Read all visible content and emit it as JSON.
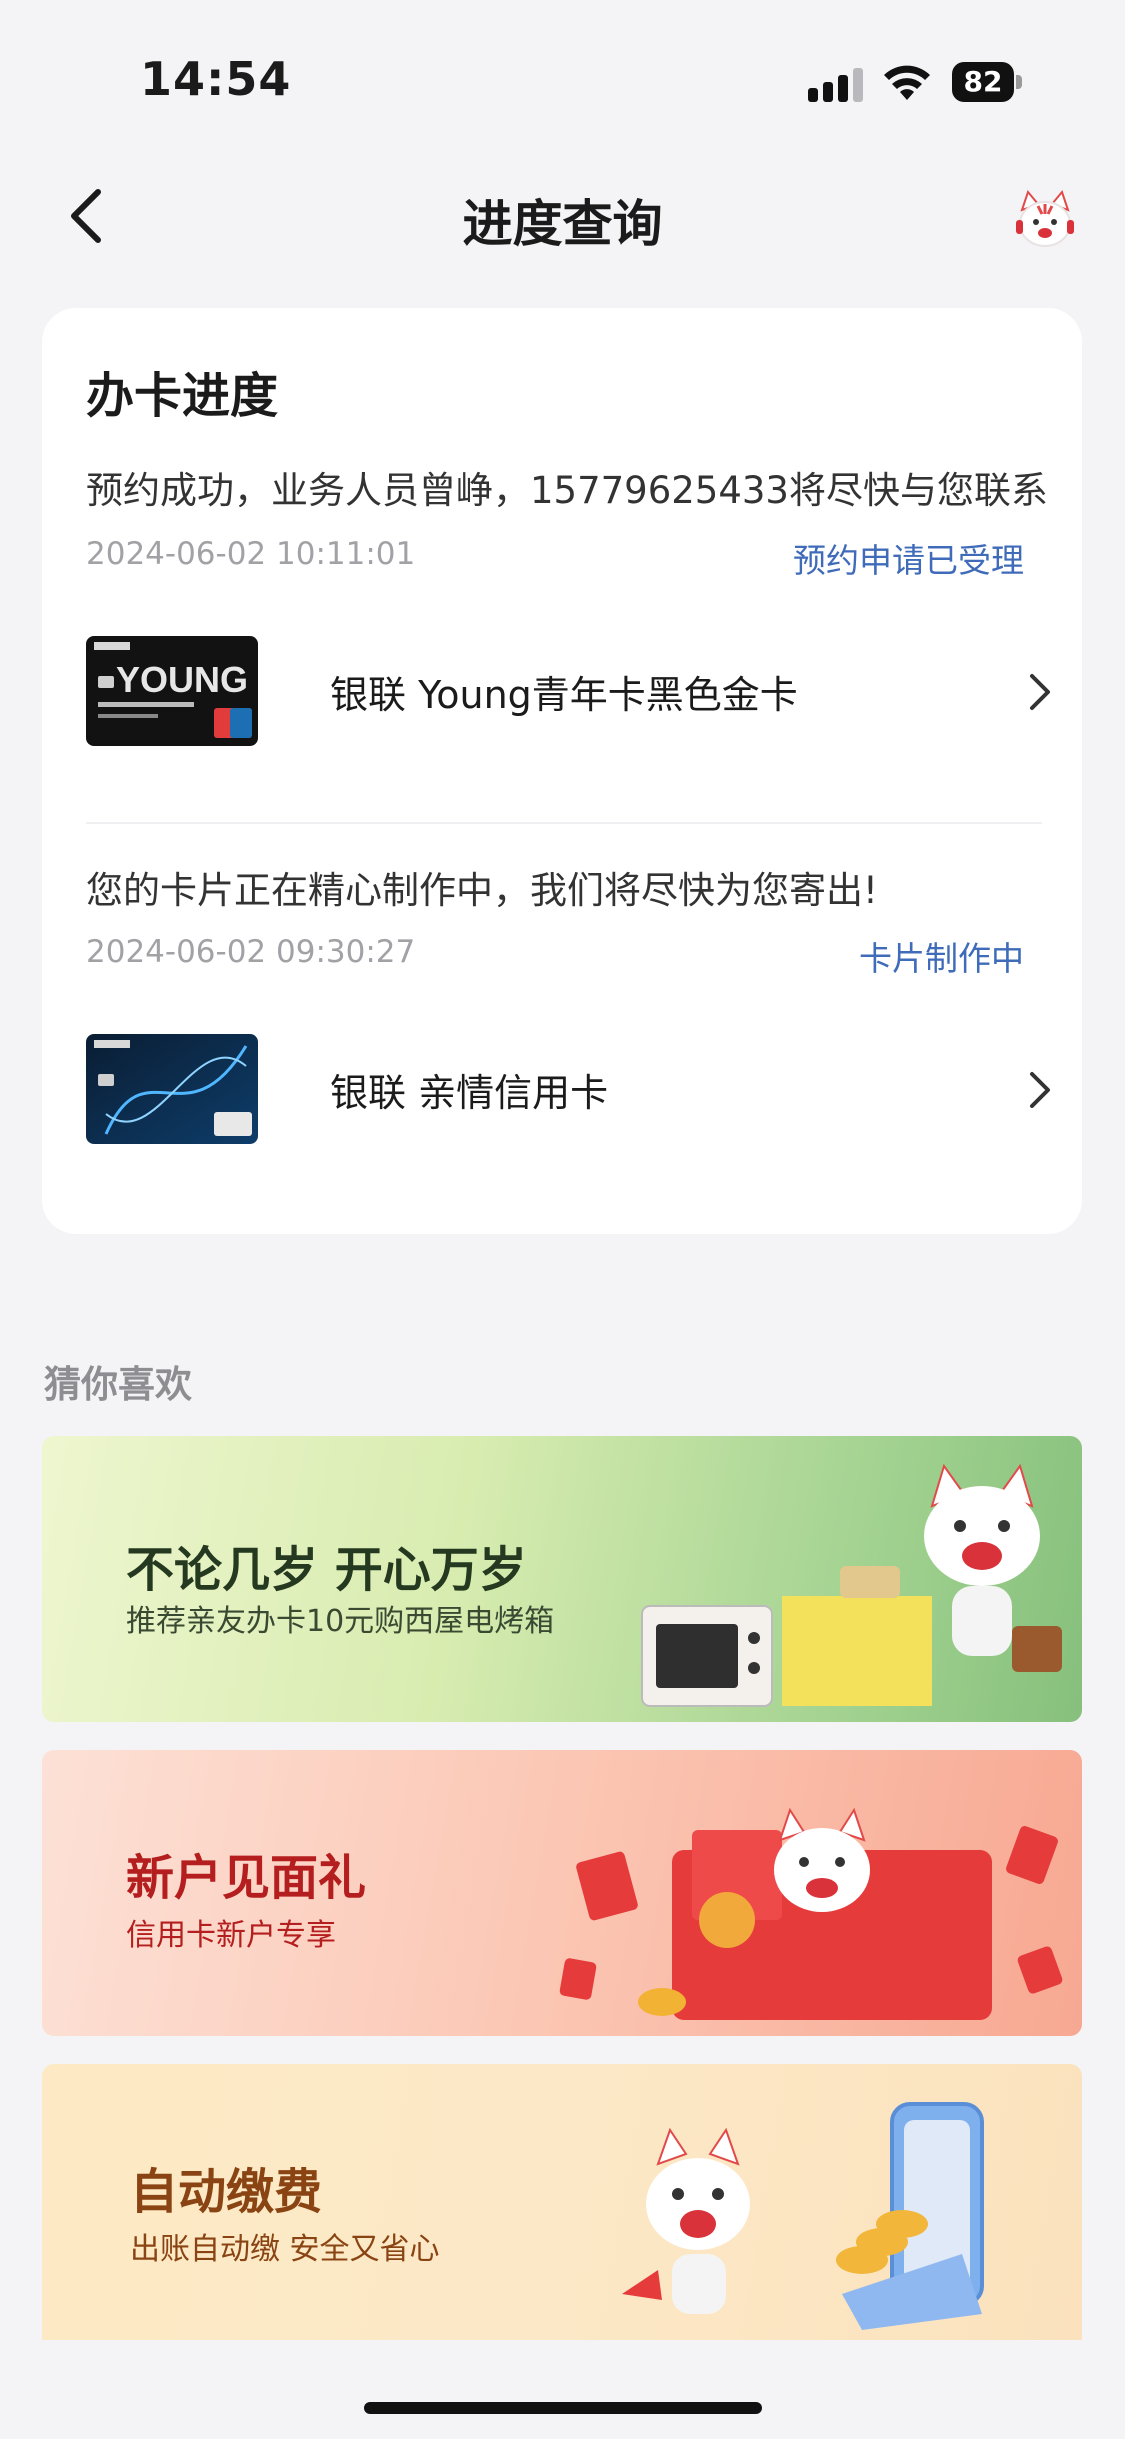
{
  "status_bar": {
    "time": "14:54",
    "battery": "82"
  },
  "nav": {
    "title": "进度查询"
  },
  "progress_card": {
    "title": "办卡进度",
    "items": [
      {
        "message": "预约成功，业务人员曾峥，15779625433将尽快与您联系",
        "timestamp": "2024-06-02 10:11:01",
        "status": "预约申请已受理",
        "product_name": "银联 Young青年卡黑色金卡"
      },
      {
        "message": "您的卡片正在精心制作中，我们将尽快为您寄出!",
        "timestamp": "2024-06-02 09:30:27",
        "status": "卡片制作中",
        "product_name": "银联 亲情信用卡"
      }
    ]
  },
  "recommendations": {
    "title": "猜你喜欢",
    "banners": [
      {
        "title": "不论几岁 开心万岁",
        "subtitle": "推荐亲友办卡10元购西屋电烤箱"
      },
      {
        "title": "新户见面礼",
        "subtitle": "信用卡新户专享"
      },
      {
        "title": "自动缴费",
        "subtitle": "出账自动缴 安全又省心"
      }
    ]
  },
  "card_art": {
    "young_text": "YOUNG"
  },
  "colors": {
    "accent_link": "#3f6bb9",
    "background": "#f4f4f6",
    "banner_red": "#e63b3b"
  }
}
